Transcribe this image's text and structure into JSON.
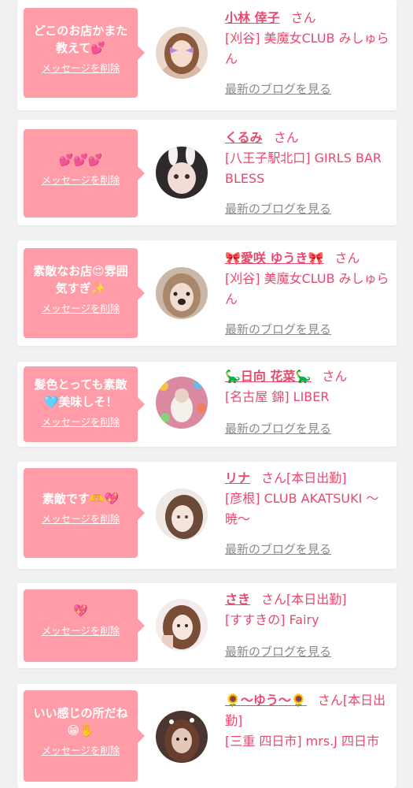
{
  "colors": {
    "background": "#f1f1f1",
    "card": "#ffffff",
    "bubble": "#ff9ca8",
    "accent": "#e8486d",
    "link_gray": "#8a8a8a"
  },
  "labels": {
    "delete_message": "メッセージを削除",
    "latest_blog": "最新のブログを見る"
  },
  "messages": [
    {
      "text": "どこのお店かまた\n教えて💕",
      "name": "小林 倖子",
      "honorific": "さん",
      "status": "",
      "shop": "[刈谷] 美魔女CLUB みしゅらん"
    },
    {
      "text": "💕💕💕",
      "name": "くるみ",
      "honorific": "さん",
      "status": "",
      "shop": "[八王子駅北口] GIRLS BAR BLESS"
    },
    {
      "text": "素敵なお店😍雰囲\n気すぎ✨",
      "name": "🎀愛咲 ゆうき🎀",
      "honorific": "さん",
      "status": "",
      "shop": "[刈谷] 美魔女CLUB みしゅらん"
    },
    {
      "text": "髪色とっても素敵\n🩵美味しそ！",
      "name": "🦕日向 花菜🦕",
      "honorific": "さん",
      "status": "",
      "shop": "[名古屋 錦] LIBER"
    },
    {
      "text": "素敵です🫶💖",
      "name": "リナ",
      "honorific": "さん",
      "status": "[本日出勤]",
      "shop": "[彦根] CLUB AKATSUKI 〜暁〜"
    },
    {
      "text": "💖",
      "name": "さき",
      "honorific": "さん",
      "status": "[本日出勤]",
      "shop": "[すすきの] Fairy"
    },
    {
      "text": "いい感じの所だね\n😁✋",
      "name": "🌻〜ゆう〜🌻",
      "honorific": "さん",
      "status": "[本日出勤]",
      "shop": "[三重 四日市] mrs.J 四日市"
    }
  ]
}
